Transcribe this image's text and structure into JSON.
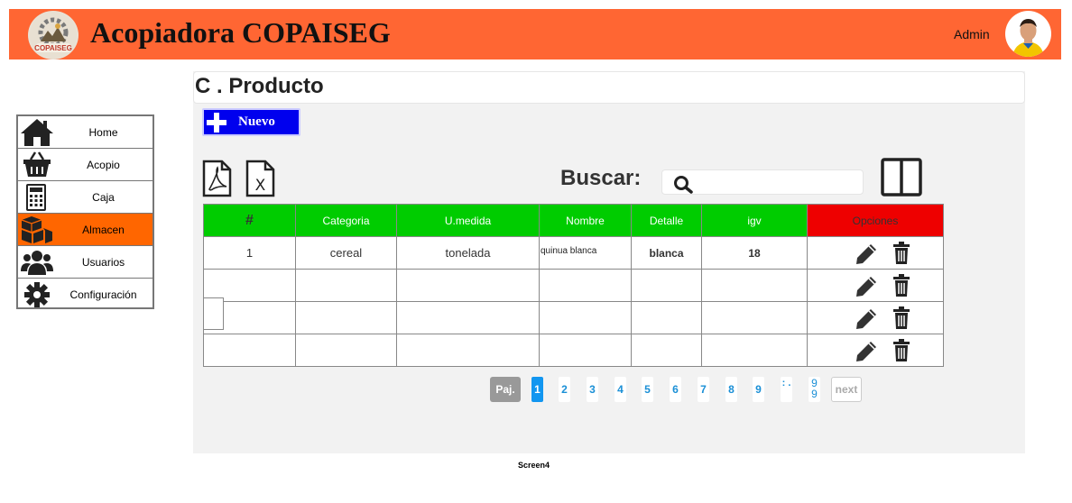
{
  "header": {
    "app_title": "Acopiadora COPAISEG",
    "user_label": "Admin",
    "logo_text": "COPAISEG",
    "accent_color": "#ff6633"
  },
  "sidebar": {
    "items": [
      {
        "label": "Home",
        "icon": "home-icon",
        "active": false
      },
      {
        "label": "Acopio",
        "icon": "basket-icon",
        "active": false
      },
      {
        "label": "Caja",
        "icon": "calculator-icon",
        "active": false
      },
      {
        "label": "Almacen",
        "icon": "boxes-icon",
        "active": true
      },
      {
        "label": "Usuarios",
        "icon": "users-icon",
        "active": false
      },
      {
        "label": "Configuración",
        "icon": "gear-icon",
        "active": false
      }
    ],
    "active_color": "#ff6600"
  },
  "main": {
    "title": "C . Producto",
    "new_button": "Nuevo",
    "search_label": "Buscar:",
    "search_value": "",
    "export_icons": [
      "pdf-icon",
      "excel-icon"
    ],
    "layout_icon": "columns-icon"
  },
  "table": {
    "headers": [
      "#",
      "Categoria",
      "U.medida",
      "Nombre",
      "Detalle",
      "igv",
      "Opciones"
    ],
    "header_color": "#00cc00",
    "options_header_color": "#ee0000",
    "rows": [
      [
        "1",
        "cereal",
        "tonelada",
        "quinua blanca",
        "blanca",
        "18"
      ],
      [
        "",
        "",
        "",
        "",
        "",
        ""
      ],
      [
        "",
        "",
        "",
        "",
        "",
        ""
      ],
      [
        "",
        "",
        "",
        "",
        "",
        ""
      ]
    ],
    "row_actions": [
      "edit-icon",
      "trash-icon"
    ]
  },
  "pagination": {
    "label": "Paj.",
    "pages": [
      "1",
      "2",
      "3",
      "4",
      "5",
      "6",
      "7",
      "8",
      "9"
    ],
    "current": "1",
    "ellipsis": ": .",
    "last": "9\n9",
    "next": "next"
  },
  "footer": {
    "caption": "Screen4"
  }
}
